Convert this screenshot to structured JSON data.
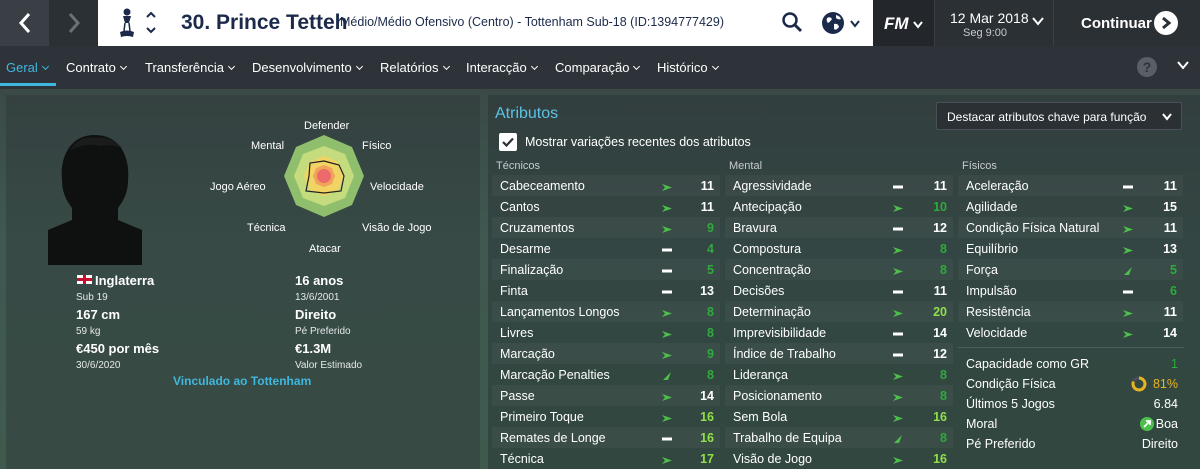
{
  "header": {
    "player_name": "30. Prince Tetteh",
    "subtitle": "Médio/Médio Ofensivo (Centro) - Tottenham Sub-18 (ID:1394777429)",
    "fm_logo": "FM",
    "date": "12 Mar 2018",
    "day_time": "Seg 9:00",
    "continue_label": "Continuar"
  },
  "tabs": [
    {
      "label": "Geral"
    },
    {
      "label": "Contrato"
    },
    {
      "label": "Transferência"
    },
    {
      "label": "Desenvolvimento"
    },
    {
      "label": "Relatórios"
    },
    {
      "label": "Interacção"
    },
    {
      "label": "Comparação"
    },
    {
      "label": "Histórico"
    }
  ],
  "help_label": "?",
  "profile": {
    "nationality": "Inglaterra",
    "intl_level": "Sub 19",
    "height": "167 cm",
    "weight": "59 kg",
    "wage": "€450 por mês",
    "contract_end": "30/6/2020",
    "age": "16 anos",
    "birth_date": "13/6/2001",
    "preferred_foot": "Direito",
    "preferred_foot_label": "Pé Preferido",
    "value": "€1.3M",
    "value_label": "Valor Estimado",
    "link": "Vinculado ao Tottenham"
  },
  "radar_labels": {
    "top": "Defender",
    "top_right": "Físico",
    "right": "Velocidade",
    "bottom_right": "Visão de Jogo",
    "bottom": "Atacar",
    "bottom_left": "Técnica",
    "left": "Jogo Aéreo",
    "top_left": "Mental"
  },
  "attributes": {
    "title": "Atributos",
    "highlight_select": "Destacar atributos chave para função",
    "show_changes_label": "Mostrar variações recentes dos atributos",
    "show_changes_checked": true,
    "col_tecnicos": "Técnicos",
    "col_mental": "Mental",
    "col_fisicos": "Físicos",
    "tecnicos": [
      {
        "name": "Cabeceamento",
        "value": "11",
        "trend": "up",
        "color": "#ffffff"
      },
      {
        "name": "Cantos",
        "value": "11",
        "trend": "up",
        "color": "#ffffff"
      },
      {
        "name": "Cruzamentos",
        "value": "9",
        "trend": "up",
        "color": "#2faa3c"
      },
      {
        "name": "Desarme",
        "value": "4",
        "trend": "flat",
        "color": "#2faa3c"
      },
      {
        "name": "Finalização",
        "value": "5",
        "trend": "flat",
        "color": "#2faa3c"
      },
      {
        "name": "Finta",
        "value": "13",
        "trend": "flat",
        "color": "#ffffff"
      },
      {
        "name": "Lançamentos Longos",
        "value": "8",
        "trend": "up",
        "color": "#2faa3c"
      },
      {
        "name": "Livres",
        "value": "8",
        "trend": "up",
        "color": "#2faa3c"
      },
      {
        "name": "Marcação",
        "value": "9",
        "trend": "up",
        "color": "#2faa3c"
      },
      {
        "name": "Marcação Penalties",
        "value": "8",
        "trend": "upbig",
        "color": "#2faa3c"
      },
      {
        "name": "Passe",
        "value": "14",
        "trend": "up",
        "color": "#ffffff"
      },
      {
        "name": "Primeiro Toque",
        "value": "16",
        "trend": "up",
        "color": "#8fe04a"
      },
      {
        "name": "Remates de Longe",
        "value": "16",
        "trend": "flat",
        "color": "#8fe04a"
      },
      {
        "name": "Técnica",
        "value": "17",
        "trend": "up",
        "color": "#8fe04a"
      }
    ],
    "mental": [
      {
        "name": "Agressividade",
        "value": "11",
        "trend": "flat",
        "color": "#ffffff"
      },
      {
        "name": "Antecipação",
        "value": "10",
        "trend": "up",
        "color": "#2faa3c"
      },
      {
        "name": "Bravura",
        "value": "12",
        "trend": "flat",
        "color": "#ffffff"
      },
      {
        "name": "Compostura",
        "value": "8",
        "trend": "up",
        "color": "#2faa3c"
      },
      {
        "name": "Concentração",
        "value": "8",
        "trend": "up",
        "color": "#2faa3c"
      },
      {
        "name": "Decisões",
        "value": "11",
        "trend": "flat",
        "color": "#ffffff"
      },
      {
        "name": "Determinação",
        "value": "20",
        "trend": "up",
        "color": "#8fe04a"
      },
      {
        "name": "Imprevisibilidade",
        "value": "14",
        "trend": "flat",
        "color": "#ffffff"
      },
      {
        "name": "Índice de Trabalho",
        "value": "12",
        "trend": "flat",
        "color": "#ffffff"
      },
      {
        "name": "Liderança",
        "value": "8",
        "trend": "up",
        "color": "#2faa3c"
      },
      {
        "name": "Posicionamento",
        "value": "8",
        "trend": "up",
        "color": "#2faa3c"
      },
      {
        "name": "Sem Bola",
        "value": "16",
        "trend": "up",
        "color": "#8fe04a"
      },
      {
        "name": "Trabalho de Equipa",
        "value": "8",
        "trend": "upbig",
        "color": "#2faa3c"
      },
      {
        "name": "Visão de Jogo",
        "value": "16",
        "trend": "up",
        "color": "#8fe04a"
      }
    ],
    "fisicos": [
      {
        "name": "Aceleração",
        "value": "11",
        "trend": "flat",
        "color": "#ffffff"
      },
      {
        "name": "Agilidade",
        "value": "15",
        "trend": "up",
        "color": "#ffffff"
      },
      {
        "name": "Condição Física Natural",
        "value": "11",
        "trend": "up",
        "color": "#ffffff"
      },
      {
        "name": "Equilíbrio",
        "value": "13",
        "trend": "up",
        "color": "#ffffff"
      },
      {
        "name": "Força",
        "value": "5",
        "trend": "upbig",
        "color": "#2faa3c"
      },
      {
        "name": "Impulsão",
        "value": "6",
        "trend": "flat",
        "color": "#2faa3c"
      },
      {
        "name": "Resistência",
        "value": "11",
        "trend": "up",
        "color": "#ffffff"
      },
      {
        "name": "Velocidade",
        "value": "14",
        "trend": "up",
        "color": "#ffffff"
      }
    ]
  },
  "stats": {
    "gk_label": "Capacidade como GR",
    "gk_value": "1",
    "condition_label": "Condição Física",
    "condition_value": "81%",
    "condition_fraction": 0.81,
    "last5_label": "Últimos 5 Jogos",
    "last5_value": "6.84",
    "morale_label": "Moral",
    "morale_value": "Boa",
    "foot_label": "Pé Preferido",
    "foot_value": "Direito"
  },
  "colors": {
    "accent": "#3fb7df",
    "trend_green": "#4cc04a",
    "good_value": "#8fe04a",
    "poor_value": "#2faa3c"
  }
}
